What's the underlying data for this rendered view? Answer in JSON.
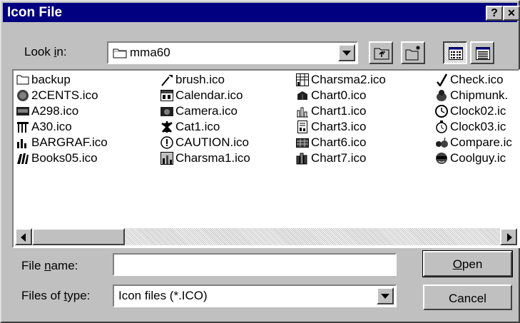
{
  "window": {
    "title": "Icon File",
    "help_glyph": "?",
    "close_glyph": "✕"
  },
  "look_in": {
    "label": "Look in:",
    "value": "mma60"
  },
  "files": [
    {
      "name": "backup",
      "icon": "folder-icon"
    },
    {
      "name": "2CENTS.ico",
      "icon": "coin-icon"
    },
    {
      "name": "A298.ico",
      "icon": "keyboard-icon"
    },
    {
      "name": "A30.ico",
      "icon": "building-icon"
    },
    {
      "name": "BARGRAF.ico",
      "icon": "bar-graph-icon"
    },
    {
      "name": "Books05.ico",
      "icon": "books-icon"
    },
    {
      "name": "brush.ico",
      "icon": "brush-icon"
    },
    {
      "name": "Calendar.ico",
      "icon": "calendar-icon"
    },
    {
      "name": "Camera.ico",
      "icon": "camera-icon"
    },
    {
      "name": "Cat1.ico",
      "icon": "cat-icon"
    },
    {
      "name": "CAUTION.ico",
      "icon": "caution-icon"
    },
    {
      "name": "Charsma1.ico",
      "icon": "chart-icon"
    },
    {
      "name": "Charsma2.ico",
      "icon": "chart-grid-icon"
    },
    {
      "name": "Chart0.ico",
      "icon": "chart-3d-icon"
    },
    {
      "name": "Chart1.ico",
      "icon": "bar-chart-icon"
    },
    {
      "name": "Chart3.ico",
      "icon": "document-chart-icon"
    },
    {
      "name": "Chart6.ico",
      "icon": "table-chart-icon"
    },
    {
      "name": "Chart7.ico",
      "icon": "stack-chart-icon"
    },
    {
      "name": "Check.ico",
      "icon": "checkmark-icon"
    },
    {
      "name": "Chipmunk.",
      "icon": "chipmunk-icon"
    },
    {
      "name": "Clock02.ic",
      "icon": "clock-icon"
    },
    {
      "name": "Clock03.ic",
      "icon": "alarm-clock-icon"
    },
    {
      "name": "Compare.ic",
      "icon": "fruit-compare-icon"
    },
    {
      "name": "Coolguy.ic",
      "icon": "coolguy-icon"
    }
  ],
  "file_name": {
    "label": "File name:",
    "value": ""
  },
  "file_type": {
    "label": "Files of type:",
    "value": "Icon files (*.ICO)"
  },
  "buttons": {
    "open": "Open",
    "cancel": "Cancel"
  },
  "colors": {
    "titlebar": "#000080",
    "face": "#c0c0c0"
  }
}
